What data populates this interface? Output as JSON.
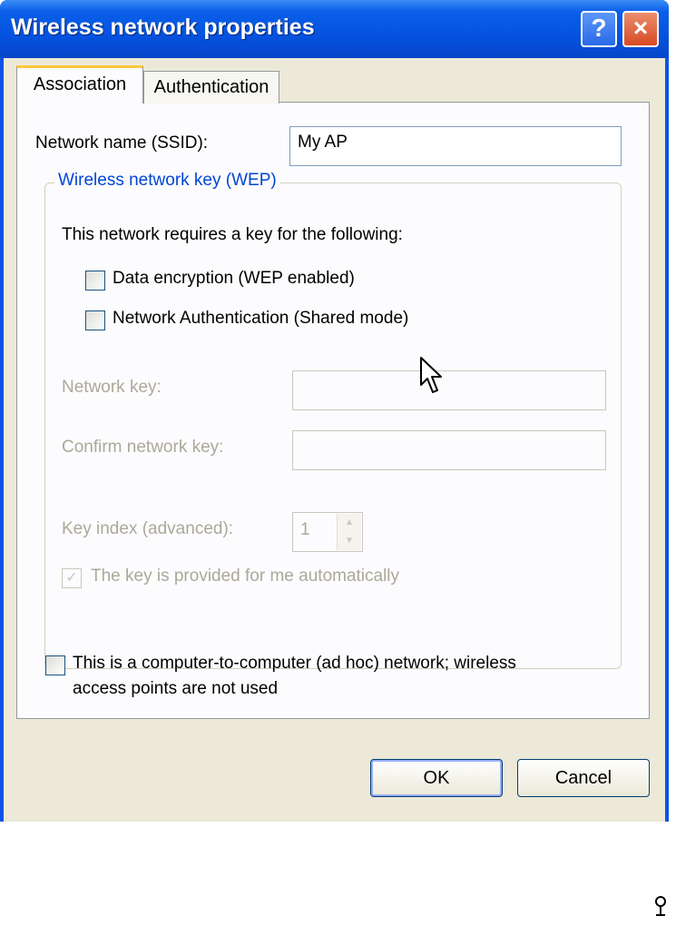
{
  "window": {
    "title": "Wireless network properties",
    "help_button": "?",
    "close_button": "×"
  },
  "tabs": [
    {
      "label": "Association",
      "active": true
    },
    {
      "label": "Authentication",
      "active": false
    }
  ],
  "association": {
    "ssid_label": "Network name (SSID):",
    "ssid_value": "My AP",
    "wep_group": {
      "legend": "Wireless network key (WEP)",
      "requires_key_text": "This network requires a key for the following:",
      "data_encryption": {
        "label": "Data encryption (WEP enabled)",
        "checked": false
      },
      "shared_auth": {
        "label": "Network Authentication (Shared mode)",
        "checked": false
      },
      "network_key_label": "Network key:",
      "network_key_value": "",
      "confirm_key_label": "Confirm network key:",
      "confirm_key_value": "",
      "key_index_label": "Key index (advanced):",
      "key_index_value": "1",
      "auto_key": {
        "label": "The key is provided for me automatically",
        "checked": true,
        "mark": "✓"
      }
    },
    "adhoc": {
      "label_line1": "This is a computer-to-computer (ad hoc) network; wireless",
      "label_line2": "access points are not used",
      "checked": false
    }
  },
  "buttons": {
    "ok": "OK",
    "cancel": "Cancel"
  },
  "colors": {
    "titlebar": "#0553e0",
    "client_bg": "#ece9d8",
    "group_legend": "#0046d5",
    "disabled_text": "#aca899"
  }
}
